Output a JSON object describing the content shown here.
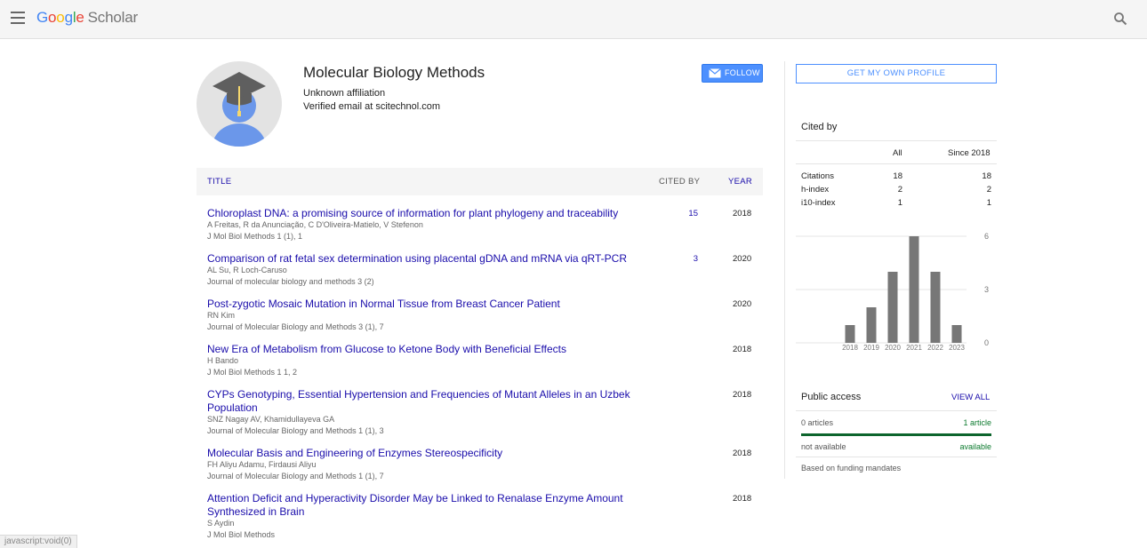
{
  "header": {
    "logo_google": [
      "G",
      "o",
      "o",
      "g",
      "l",
      "e"
    ],
    "logo_scholar": "Scholar"
  },
  "profile": {
    "name": "Molecular Biology Methods",
    "affiliation": "Unknown affiliation",
    "email": "Verified email at scitechnol.com",
    "follow_label": "FOLLOW"
  },
  "table": {
    "headers": {
      "title": "TITLE",
      "cited_by": "CITED BY",
      "year": "YEAR"
    },
    "rows": [
      {
        "title": "Chloroplast DNA: a promising source of information for plant phylogeny and traceability",
        "authors": "A Freitas, R da Anunciação, C D'Oliveira-Matielo, V Stefenon",
        "venue": "J Mol Biol Methods 1 (1), 1",
        "cited": "15",
        "year": "2018"
      },
      {
        "title": "Comparison of rat fetal sex determination using placental gDNA and mRNA via qRT-PCR",
        "authors": "AL Su, R Loch-Caruso",
        "venue": "Journal of molecular biology and methods 3 (2)",
        "cited": "3",
        "year": "2020"
      },
      {
        "title": "Post-zygotic Mosaic Mutation in Normal Tissue from Breast Cancer Patient",
        "authors": "RN Kim",
        "venue": "Journal of Molecular Biology and Methods 3 (1), 7",
        "cited": "",
        "year": "2020"
      },
      {
        "title": "New Era of Metabolism from Glucose to Ketone Body with Beneficial Effects",
        "authors": "H Bando",
        "venue": "J Mol Biol Methods 1 1, 2",
        "cited": "",
        "year": "2018"
      },
      {
        "title": "CYPs Genotyping, Essential Hypertension and Frequencies of Mutant Alleles in an Uzbek Population",
        "authors": "SNZ Nagay AV, Khamidullayeva GA",
        "venue": "Journal of Molecular Biology and Methods 1 (1), 3",
        "cited": "",
        "year": "2018"
      },
      {
        "title": "Molecular Basis and Engineering of Enzymes Stereospecificity",
        "authors": "FH Aliyu Adamu, Firdausi Aliyu",
        "venue": "Journal of Molecular Biology and Methods 1 (1), 7",
        "cited": "",
        "year": "2018"
      },
      {
        "title": "Attention Deficit and Hyperactivity Disorder May be Linked to Renalase Enzyme Amount Synthesized in Brain",
        "authors": "S Aydin",
        "venue": "J Mol Biol Methods",
        "cited": "",
        "year": "2018"
      }
    ]
  },
  "sidebar": {
    "own_profile_label": "GET MY OWN PROFILE",
    "cited_by_title": "Cited by",
    "col_all": "All",
    "col_since": "Since 2018",
    "metrics": [
      {
        "label": "Citations",
        "all": "18",
        "since": "18"
      },
      {
        "label": "h-index",
        "all": "2",
        "since": "2"
      },
      {
        "label": "i10-index",
        "all": "1",
        "since": "1"
      }
    ],
    "public_access": {
      "title": "Public access",
      "view_all": "VIEW ALL",
      "not_avail_count": "0 articles",
      "avail_count": "1 article",
      "not_avail_label": "not available",
      "avail_label": "available",
      "note": "Based on funding mandates"
    }
  },
  "chart_data": {
    "type": "bar",
    "categories": [
      "2018",
      "2019",
      "2020",
      "2021",
      "2022",
      "2023"
    ],
    "values": [
      1,
      2,
      4,
      6,
      4,
      1
    ],
    "yticks": [
      "0",
      "3",
      "6"
    ],
    "ylim": [
      0,
      6
    ],
    "bar_color": "#777777"
  },
  "statusbar": {
    "text": "javascript:void(0)"
  }
}
